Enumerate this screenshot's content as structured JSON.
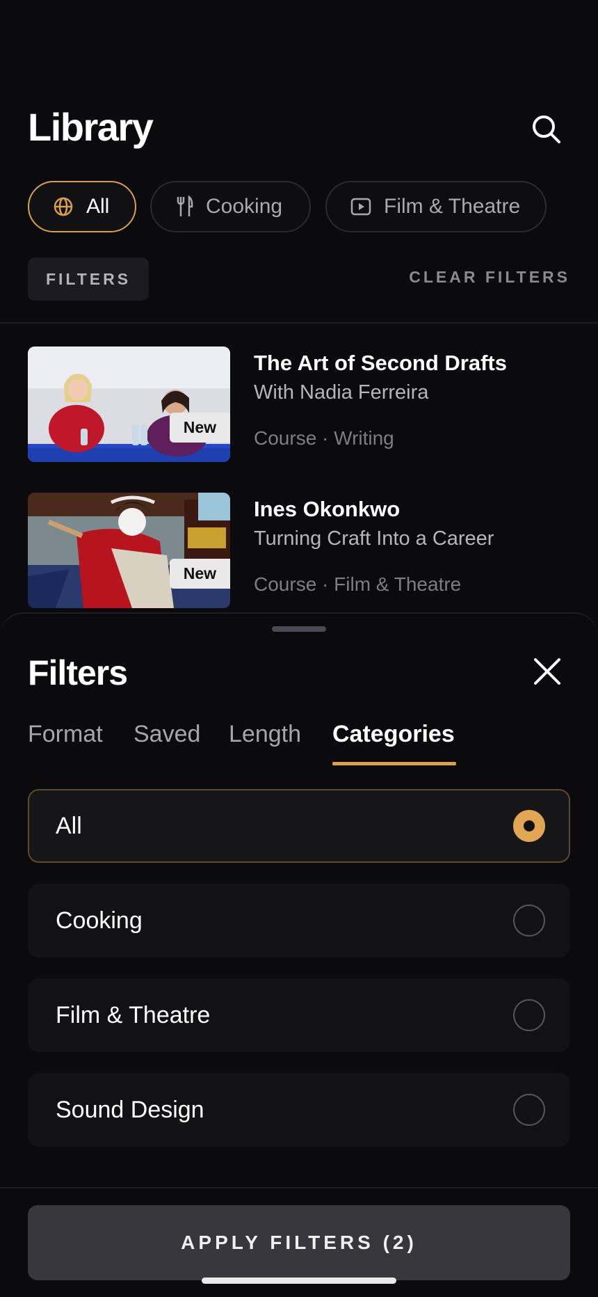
{
  "header": {
    "title": "Library"
  },
  "chips": [
    {
      "label": "All",
      "icon": "globe-icon",
      "active": true
    },
    {
      "label": "Cooking",
      "icon": "utensils-icon",
      "active": false
    },
    {
      "label": "Film & Theatre",
      "icon": "play-icon",
      "active": false
    }
  ],
  "filter_bar": {
    "filters_label": "FILTERS",
    "clear_label": "CLEAR FILTERS"
  },
  "items": [
    {
      "title": "The Art of Second Drafts",
      "subtitle": "With Nadia Ferreira",
      "meta": "Course · Writing",
      "badge": "New"
    },
    {
      "title": "Ines Okonkwo",
      "subtitle": "Turning Craft Into a Career",
      "meta": "Course · Film & Theatre",
      "badge": "New"
    }
  ],
  "sheet": {
    "title": "Filters",
    "tabs": [
      "Format",
      "Saved",
      "Length",
      "Categories"
    ],
    "active_tab": "Categories",
    "options": [
      {
        "label": "All",
        "selected": true
      },
      {
        "label": "Cooking",
        "selected": false
      },
      {
        "label": "Film & Theatre",
        "selected": false
      },
      {
        "label": "Sound Design",
        "selected": false
      }
    ],
    "apply_label": "APPLY FILTERS (2)"
  },
  "colors": {
    "accent": "#d9a24a",
    "background": "#0b0b0e",
    "surface": "#121215"
  }
}
